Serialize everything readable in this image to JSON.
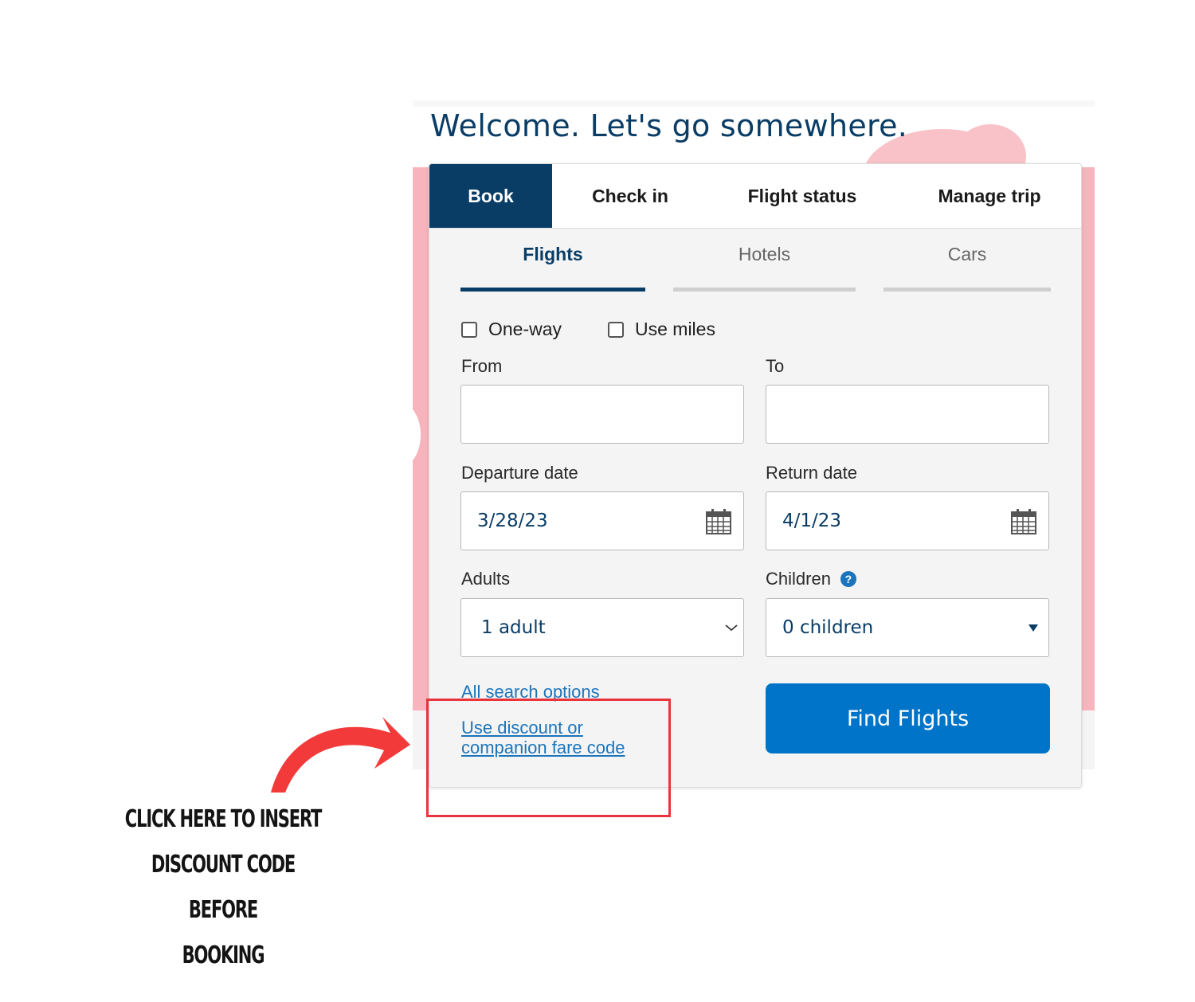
{
  "hero": {
    "welcome": "Welcome. Let's go somewhere."
  },
  "top_tabs": [
    "Book",
    "Check in",
    "Flight status",
    "Manage trip"
  ],
  "sub_tabs": [
    "Flights",
    "Hotels",
    "Cars"
  ],
  "options": {
    "one_way": "One-way",
    "use_miles": "Use miles"
  },
  "form": {
    "from_label": "From",
    "to_label": "To",
    "departure_label": "Departure date",
    "departure_value": "3/28/23",
    "return_label": "Return date",
    "return_value": "4/1/23",
    "adults_label": "Adults",
    "adults_value": "1 adult",
    "children_label": "Children",
    "children_value": "0 children",
    "help_icon": "?"
  },
  "links": {
    "all_search": "All search options",
    "discount_line1": "Use discount or",
    "discount_line2": "companion fare code"
  },
  "find_button": "Find Flights",
  "annotation": {
    "line1": "CLICK HERE TO INSERT",
    "line2": "DISCOUNT CODE BEFORE",
    "line3": "BOOKING"
  },
  "colors": {
    "brand_navy": "#0a3d66",
    "button_blue": "#0074c8",
    "link_blue": "#1b75bc",
    "annotation_red": "#e8343a",
    "pink_background": "#f8b4bc"
  },
  "icons": [
    "calendar-icon",
    "chevron-down-icon",
    "caret-down-icon",
    "help-icon",
    "curved-arrow-icon"
  ]
}
